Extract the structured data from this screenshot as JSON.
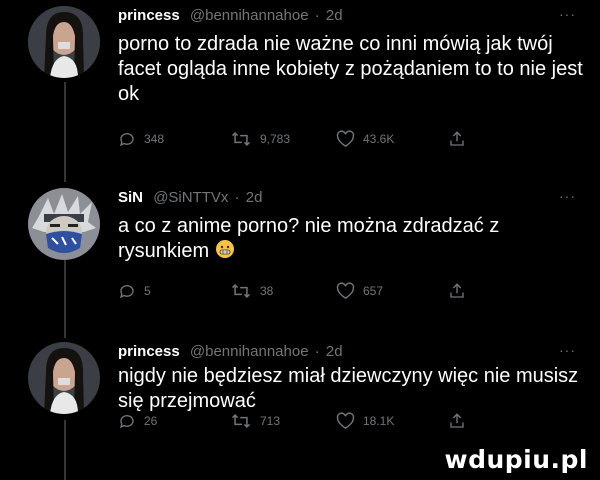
{
  "tweets": [
    {
      "name": "princess",
      "handle": "@bennihannahoe",
      "time": "2d",
      "more": "···",
      "text": "porno to zdrada nie ważne co inni mówią jak twój facet ogląda inne kobiety z pożądaniem to to nie jest ok",
      "replies": "348",
      "retweets": "9,783",
      "likes": "43.6K"
    },
    {
      "name": "SiN",
      "handle": "@SiNTTVx",
      "time": "2d",
      "more": "···",
      "text": "a co z anime porno? nie można zdradzać z rysunkiem",
      "replies": "5",
      "retweets": "38",
      "likes": "657"
    },
    {
      "name": "princess",
      "handle": "@bennihannahoe",
      "time": "2d",
      "more": "···",
      "text": "nigdy nie będziesz miał dziewczyny więc nie musisz się przejmować",
      "replies": "26",
      "retweets": "713",
      "likes": "18.1K"
    }
  ],
  "watermark": "wdupiu.pl",
  "colors": {
    "background": "#000000",
    "text": "#ffffff",
    "muted": "#71767b",
    "thread": "#333639"
  }
}
